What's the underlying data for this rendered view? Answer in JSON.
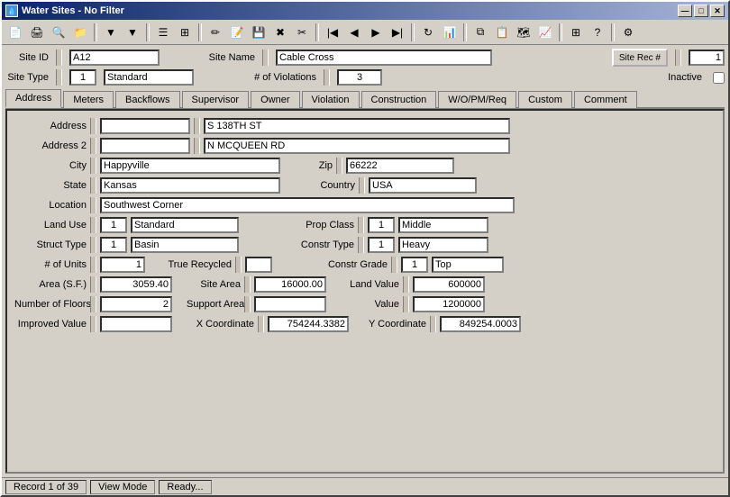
{
  "window": {
    "title": "Water Sites - No Filter"
  },
  "title_buttons": {
    "minimize": "—",
    "maximize": "□",
    "close": "✕"
  },
  "toolbar_buttons": [
    {
      "name": "print",
      "icon": "🖨"
    },
    {
      "name": "preview",
      "icon": "🔍"
    },
    {
      "name": "open",
      "icon": "📂"
    },
    {
      "name": "filter",
      "icon": "▼"
    },
    {
      "name": "refresh",
      "icon": "↻"
    },
    {
      "name": "new",
      "icon": "📄"
    },
    {
      "name": "edit",
      "icon": "✏"
    },
    {
      "name": "save",
      "icon": "💾"
    },
    {
      "name": "delete",
      "icon": "✖"
    },
    {
      "name": "cut",
      "icon": "✂"
    },
    {
      "name": "first",
      "icon": "|◀"
    },
    {
      "name": "prev",
      "icon": "◀"
    },
    {
      "name": "next",
      "icon": "▶"
    },
    {
      "name": "last",
      "icon": "▶|"
    }
  ],
  "header": {
    "site_id_label": "Site ID",
    "site_id_value": "A12",
    "site_name_label": "Site Name",
    "site_name_value": "Cable Cross",
    "site_rec_label": "Site Rec #",
    "site_rec_value": "1",
    "site_type_label": "Site Type",
    "site_type_code": "1",
    "site_type_value": "Standard",
    "violations_label": "# of Violations",
    "violations_value": "3",
    "inactive_label": "Inactive",
    "inactive_checked": false
  },
  "tabs": [
    "Address",
    "Meters",
    "Backflows",
    "Supervisor",
    "Owner",
    "Violation",
    "Construction",
    "W/O/PM/Req",
    "Custom",
    "Comment"
  ],
  "active_tab": "Address",
  "address": {
    "address_label": "Address",
    "address_value": "S 138TH ST",
    "address2_label": "Address 2",
    "address2_value": "N MCQUEEN RD",
    "city_label": "City",
    "city_value": "Happyville",
    "zip_label": "Zip",
    "zip_value": "66222",
    "state_label": "State",
    "state_value": "Kansas",
    "country_label": "Country",
    "country_value": "USA",
    "location_label": "Location",
    "location_value": "Southwest Corner",
    "land_use_label": "Land Use",
    "land_use_code": "1",
    "land_use_value": "Standard",
    "prop_class_label": "Prop Class",
    "prop_class_code": "1",
    "prop_class_value": "Middle",
    "struct_type_label": "Struct Type",
    "struct_type_code": "1",
    "struct_type_value": "Basin",
    "constr_type_label": "Constr Type",
    "constr_type_code": "1",
    "constr_type_value": "Heavy",
    "units_label": "# of Units",
    "units_value": "1",
    "true_recycled_label": "True Recycled",
    "constr_grade_label": "Constr Grade",
    "constr_grade_code": "1",
    "constr_grade_value": "Top",
    "area_sf_label": "Area (S.F.)",
    "area_sf_value": "3059.40",
    "site_area_label": "Site Area",
    "site_area_value": "16000.00",
    "land_value_label": "Land Value",
    "land_value_value": "600000",
    "num_floors_label": "Number of Floors",
    "num_floors_value": "2",
    "support_area_label": "Support Area",
    "support_area_value": "",
    "value_label": "Value",
    "value_value": "1200000",
    "improved_value_label": "Improved Value",
    "improved_value_value": "",
    "x_coord_label": "X Coordinate",
    "x_coord_value": "754244.3382",
    "y_coord_label": "Y Coordinate",
    "y_coord_value": "849254.0003"
  },
  "status": {
    "record": "Record 1 of 39",
    "mode": "View Mode",
    "state": "Ready..."
  }
}
